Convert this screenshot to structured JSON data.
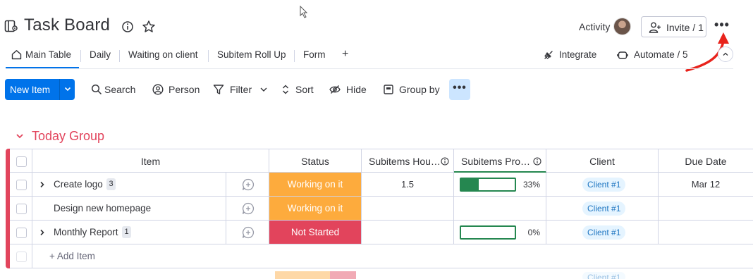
{
  "header": {
    "title": "Task Board",
    "activity_label": "Activity",
    "invite_label": "Invite / 1",
    "more_label": "•••"
  },
  "tabs": {
    "items": [
      {
        "label": "Main Table"
      },
      {
        "label": "Daily"
      },
      {
        "label": "Waiting on client"
      },
      {
        "label": "Subitem Roll Up"
      },
      {
        "label": "Form"
      },
      {
        "label": "+"
      }
    ],
    "integrate_label": "Integrate",
    "automate_label": "Automate / 5"
  },
  "toolbar": {
    "new_item_label": "New Item",
    "search_label": "Search",
    "person_label": "Person",
    "filter_label": "Filter",
    "sort_label": "Sort",
    "hide_label": "Hide",
    "group_by_label": "Group by",
    "more_label": "•••"
  },
  "group": {
    "title": "Today Group",
    "color": "#e2445c",
    "columns": {
      "item": "Item",
      "status": "Status",
      "sub_hours": "Subitems Hou…",
      "sub_progress": "Subitems Pro…",
      "client": "Client",
      "due_date": "Due Date"
    },
    "rows": [
      {
        "name": "Create logo",
        "subitems": "3",
        "status": "Working on it",
        "status_color": "#fdab3d",
        "hours": "1.5",
        "progress": 0.33,
        "progress_label": "33%",
        "client": "Client #1",
        "due": "Mar 12"
      },
      {
        "name": "Design new homepage",
        "subitems": "",
        "status": "Working on it",
        "status_color": "#fdab3d",
        "hours": "",
        "progress": null,
        "progress_label": "",
        "client": "Client #1",
        "due": ""
      },
      {
        "name": "Monthly Report",
        "subitems": "1",
        "status": "Not Started",
        "status_color": "#e2445c",
        "hours": "",
        "progress": 0,
        "progress_label": "0%",
        "client": "Client #1",
        "due": ""
      }
    ],
    "add_item_label": "+ Add Item"
  },
  "footer_partial": {
    "client": "Client #1"
  },
  "colors": {
    "accent": "#0073ea",
    "working": "#fdab3d",
    "not_started": "#e2445c",
    "progress": "#258750",
    "annotation_arrow": "#e8231c"
  }
}
